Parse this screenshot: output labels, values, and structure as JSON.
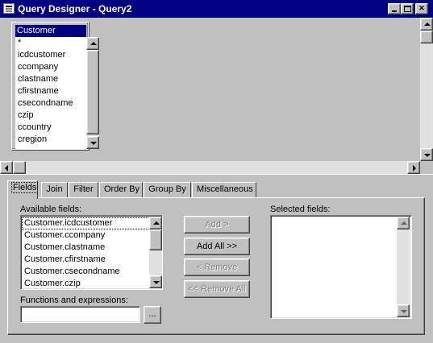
{
  "window": {
    "title": "Query Designer - Query2"
  },
  "table_box": {
    "title": "Customer",
    "fields": [
      "*",
      "icdcustomer",
      "ccompany",
      "clastname",
      "cfirstname",
      "csecondname",
      "czip",
      "ccountry",
      "cregion"
    ]
  },
  "tabs": [
    {
      "label": "Fields",
      "active": true
    },
    {
      "label": "Join",
      "active": false
    },
    {
      "label": "Filter",
      "active": false
    },
    {
      "label": "Order By",
      "active": false
    },
    {
      "label": "Group By",
      "active": false
    },
    {
      "label": "Miscellaneous",
      "active": false
    }
  ],
  "fields_tab": {
    "available_label": "Available fields:",
    "available_fields": [
      "Customer.icdcustomer",
      "Customer.ccompany",
      "Customer.clastname",
      "Customer.cfirstname",
      "Customer.csecondname",
      "Customer.czip"
    ],
    "selected_label": "Selected fields:",
    "selected_fields": [],
    "add_label": "Add >",
    "add_all_label": "Add All >>",
    "remove_label": "< Remove",
    "remove_all_label": "<< Remove All",
    "functions_label": "Functions and expressions:",
    "functions_value": "",
    "ellipsis_label": "..."
  }
}
